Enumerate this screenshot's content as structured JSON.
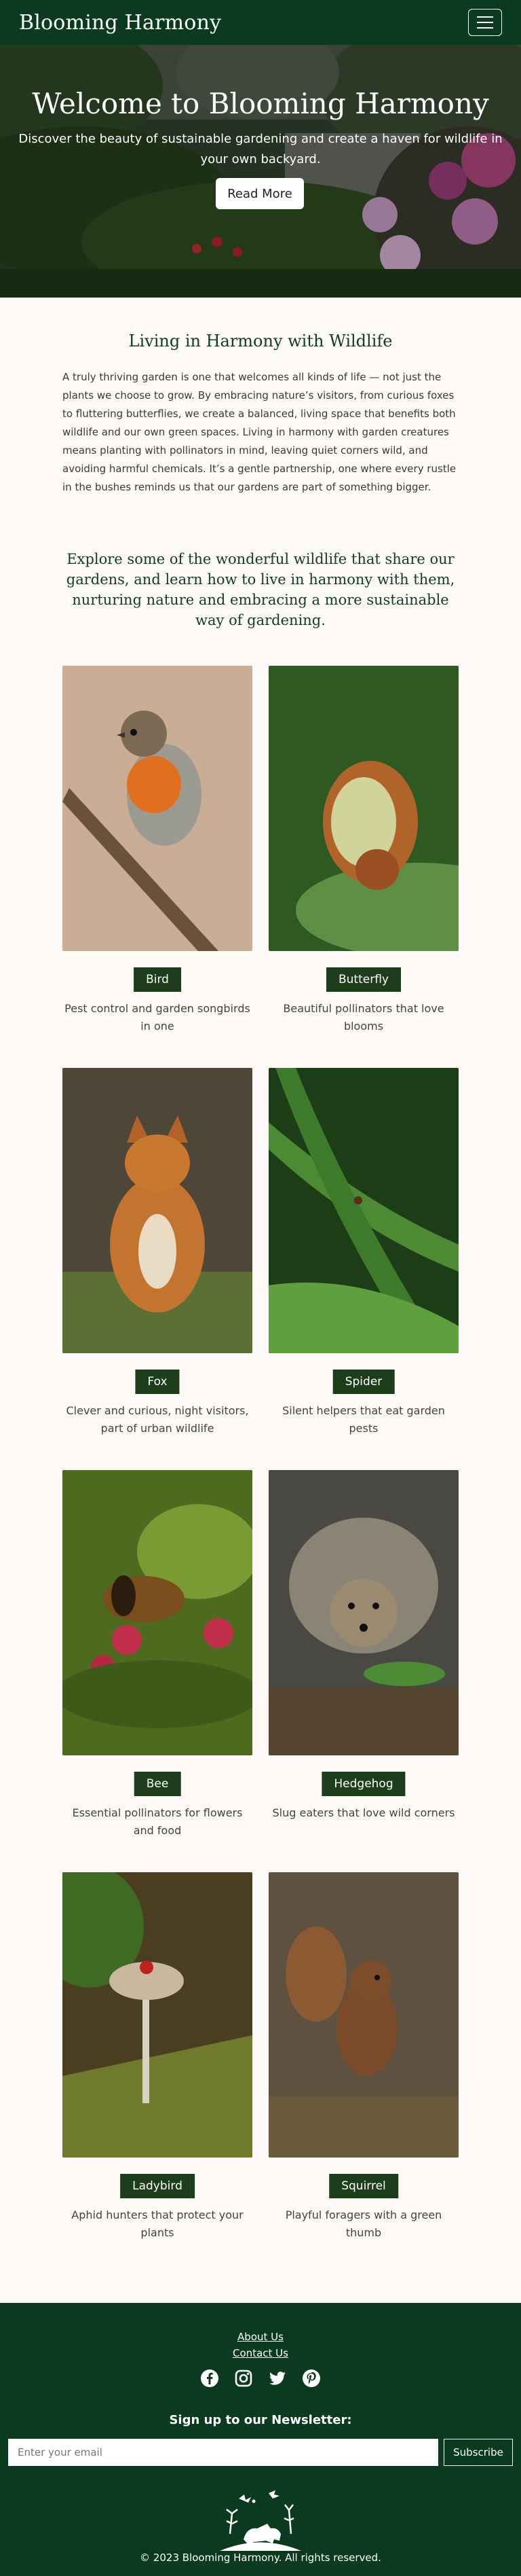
{
  "nav": {
    "brand": "Blooming Harmony"
  },
  "hero": {
    "title": "Welcome to Blooming Harmony",
    "subtitle": "Discover the beauty of sustainable gardening and create a haven for wildlife in your own backyard.",
    "cta": "Read More"
  },
  "intro": {
    "heading": "Living in Harmony with Wildlife",
    "body": "A truly thriving garden is one that welcomes all kinds of life — not just the plants we choose to grow. By embracing nature’s visitors, from curious foxes to fluttering butterflies, we create a balanced, living space that benefits both wildlife and our own green spaces. Living in harmony with garden creatures means planting with pollinators in mind, leaving quiet corners wild, and avoiding harmful chemicals. It’s a gentle partnership, one where every rustle in the bushes reminds us that our gardens are part of something bigger."
  },
  "lead": "Explore some of the wonderful wildlife that share our gardens, and learn how to live in harmony with them, nurturing nature and embracing a more sustainable way of gardening.",
  "cards": [
    {
      "label": "Bird",
      "desc": "Pest control and garden songbirds in one"
    },
    {
      "label": "Butterfly",
      "desc": "Beautiful pollinators that love blooms"
    },
    {
      "label": "Fox",
      "desc": "Clever and curious, night visitors, part of urban wildlife"
    },
    {
      "label": "Spider",
      "desc": "Silent helpers that eat garden pests"
    },
    {
      "label": "Bee",
      "desc": "Essential pollinators for flowers and food"
    },
    {
      "label": "Hedgehog",
      "desc": "Slug eaters that love wild corners"
    },
    {
      "label": "Ladybird",
      "desc": "Aphid hunters that protect your plants"
    },
    {
      "label": "Squirrel",
      "desc": "Playful foragers with a green thumb"
    }
  ],
  "footer": {
    "about": "About Us",
    "contact": "Contact Us",
    "social_icons": [
      "facebook-icon",
      "instagram-icon",
      "twitter-icon",
      "pinterest-icon"
    ],
    "newsletter": "Sign up to our Newsletter:",
    "email_placeholder": "Enter your email",
    "subscribe": "Subscribe",
    "copyright": "© 2023 Blooming Harmony. All rights reserved."
  },
  "colors": {
    "brand_green": "#0a3b1f",
    "tag_green": "#1e3d1a",
    "heading_green": "#12401f",
    "page_bg": "#fcf9f6"
  }
}
